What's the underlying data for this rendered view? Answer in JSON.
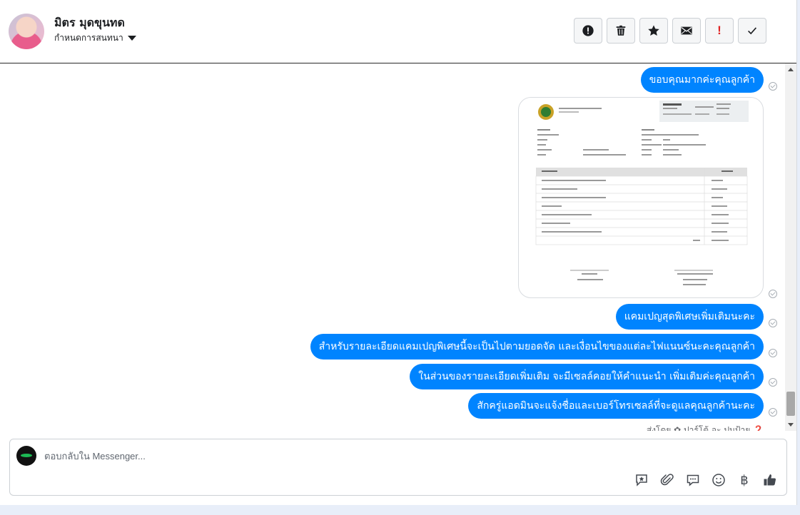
{
  "contact": {
    "name": "มิตร มุดขุนทด",
    "assign_label": "กำหนดการสนทนา"
  },
  "toolbar": {
    "buttons": [
      {
        "name": "spam",
        "icon": "alert-circle-icon"
      },
      {
        "name": "delete",
        "icon": "trash-icon"
      },
      {
        "name": "star",
        "icon": "star-icon"
      },
      {
        "name": "mark-unread",
        "icon": "envelope-icon"
      },
      {
        "name": "follow-up",
        "label": "!",
        "color": "#e02424"
      },
      {
        "name": "mark-done",
        "icon": "check-icon"
      }
    ]
  },
  "messages": {
    "thanks": "ขอบคุณมากค่ะคุณลูกค้า",
    "campaign": "แคมเปญสุดพิเศษเพิ่มเติมนะคะ",
    "details": "สำหรับรายละเอียดแคมเปญพิเศษนี้จะเป็นไปตามยอดจัด และเงื่อนไขของแต่ละไฟแนนซ์นะคะคุณลูกค้า",
    "more_info": "ในส่วนของรายละเอียดเพิ่มเติม จะมีเซลล์คอยให้คำแนะนำ เพิ่มเติมค่ะคุณลูกค้า",
    "wait": "สักครู่แอดมินจะแจ้งชื่อและเบอร์โทรเซลล์ที่จะดูแลคุณลูกค้านะคะ",
    "footer": "ส่งโดย ✿ ปาร์โต้ อะ ปมป้าย ❓"
  },
  "composer": {
    "placeholder": "ตอบกลับใน Messenger..."
  },
  "colors": {
    "bubble": "#0084ff",
    "follow_up": "#e02424"
  }
}
